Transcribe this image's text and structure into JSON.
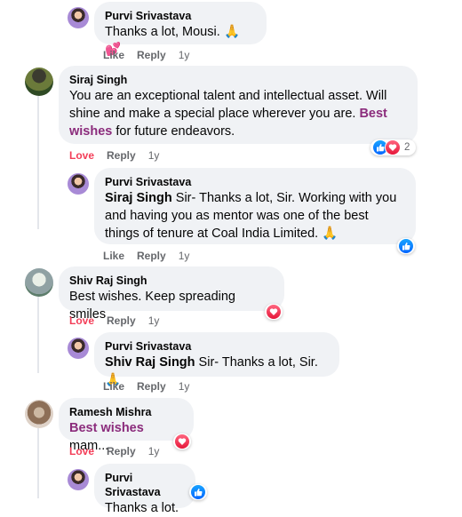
{
  "comments": [
    {
      "name": "Purvi Srivastava",
      "text": "Thanks a lot, Mousi.",
      "emoji": "🙏💕",
      "actions": {
        "like": "Like",
        "reply": "Reply",
        "time": "1y"
      }
    },
    {
      "name": "Siraj Singh",
      "text_main": "You are an exceptional talent and intellectual asset. Will shine and make a special place wherever you are.",
      "text_tag": "Best wishes",
      "text_tail": "for future endeavors.",
      "actions": {
        "react": "Love",
        "reply": "Reply",
        "time": "1y"
      },
      "reactions": {
        "count": "2",
        "types": [
          "like",
          "love"
        ]
      }
    },
    {
      "name": "Purvi Srivastava",
      "mention": "Siraj Singh",
      "text": "Sir- Thanks a lot, Sir. Working with you and having you as mentor was one of the best things of tenure at Coal India Limited.",
      "emoji": "🙏",
      "actions": {
        "like": "Like",
        "reply": "Reply",
        "time": "1y"
      },
      "reactions": {
        "types": [
          "like"
        ]
      }
    },
    {
      "name": "Shiv Raj Singh",
      "text": "Best wishes. Keep spreading smiles",
      "actions": {
        "react": "Love",
        "reply": "Reply",
        "time": "1y"
      },
      "reactions": {
        "types": [
          "love"
        ]
      }
    },
    {
      "name": "Purvi Srivastava",
      "mention": "Shiv Raj Singh",
      "text": "Sir- Thanks a lot, Sir.",
      "emoji": "🙏",
      "actions": {
        "like": "Like",
        "reply": "Reply",
        "time": "1y"
      }
    },
    {
      "name": "Ramesh Mishra",
      "text_tag": "Best wishes",
      "text_tail": "mam...",
      "actions": {
        "react": "Love",
        "reply": "Reply",
        "time": "1y"
      },
      "reactions": {
        "types": [
          "love"
        ]
      }
    },
    {
      "name": "Purvi Srivastava",
      "text": "Thanks a lot.",
      "reactions": {
        "types": [
          "like"
        ]
      }
    }
  ],
  "colors": {
    "love": "#f33e58",
    "tag": "#8b2c7c",
    "bubble": "#f0f2f5",
    "like": "#0566ff"
  }
}
